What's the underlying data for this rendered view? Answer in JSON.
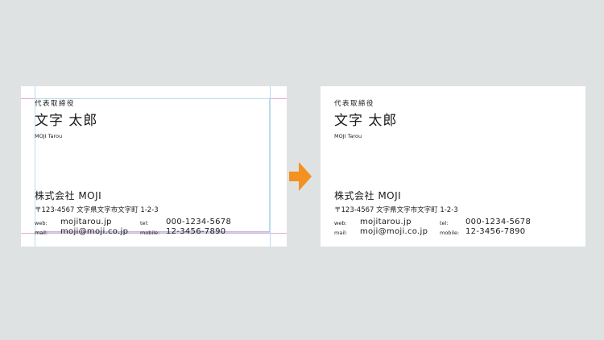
{
  "card": {
    "title": "代表取締役",
    "name": "文字 太郎",
    "romaji": "MOJI Tarou",
    "company": "株式会社 MOJI",
    "address": "〒123-4567 文字県文字市文字町 1-2-3",
    "contact": {
      "web_label": "web:",
      "web_value": "mojitarou.jp",
      "tel_label": "tel:",
      "tel_value": "000-1234-5678",
      "mail_label": "mail:",
      "mail_value": "moji@moji.co.jp",
      "mobile_label": "mobile:",
      "mobile_value": "12-3456-7890"
    }
  },
  "colors": {
    "background": "#dfe2e3",
    "card": "#ffffff",
    "arrow": "#f39121",
    "guide_magenta": "#e9a7cf",
    "guide_cyan": "#b5dfe8"
  },
  "icons": {
    "arrow": "arrow-right-icon"
  }
}
